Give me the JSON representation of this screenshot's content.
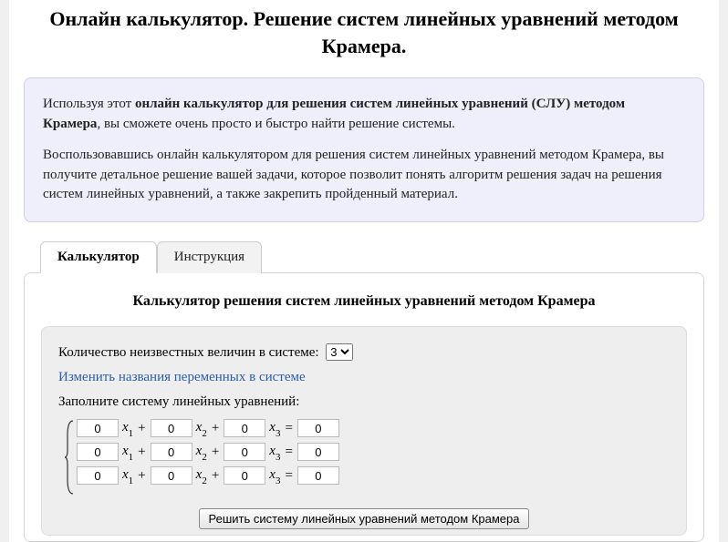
{
  "page_title_line1": "Онлайн калькулятор. Решение систем линейных уравнений методом",
  "page_title_line2": "Крамера.",
  "intro": {
    "p1_a": "Используя этот ",
    "p1_b": "онлайн калькулятор для решения систем линейных уравнений (СЛУ) методом Крамера",
    "p1_c": ", вы сможете очень просто и быстро найти решение системы.",
    "p2": "Воспользовавшись онлайн калькулятором для решения систем линейных уравнений методом Крамера, вы получите детальное решение вашей задачи, которое позволит понять алгоритм решения задач на решения систем линейных уравнений, а также закрепить пройденный материал."
  },
  "tabs": {
    "calculator": "Калькулятор",
    "instruction": "Инструкция"
  },
  "panel": {
    "heading": "Калькулятор решения систем линейных уравнений методом Крамера",
    "unknowns_label": "Количество неизвестных величин в системе:",
    "unknowns_selected": "3",
    "rename_link": "Изменить названия переменных в системе",
    "fill_label": "Заполните систему линейных уравнений:",
    "var_name": "x",
    "rows": [
      {
        "coefs": [
          "0",
          "0",
          "0"
        ],
        "rhs": "0"
      },
      {
        "coefs": [
          "0",
          "0",
          "0"
        ],
        "rhs": "0"
      },
      {
        "coefs": [
          "0",
          "0",
          "0"
        ],
        "rhs": "0"
      }
    ],
    "solve_button": "Решить систему линейных уравнений методом Крамера"
  }
}
